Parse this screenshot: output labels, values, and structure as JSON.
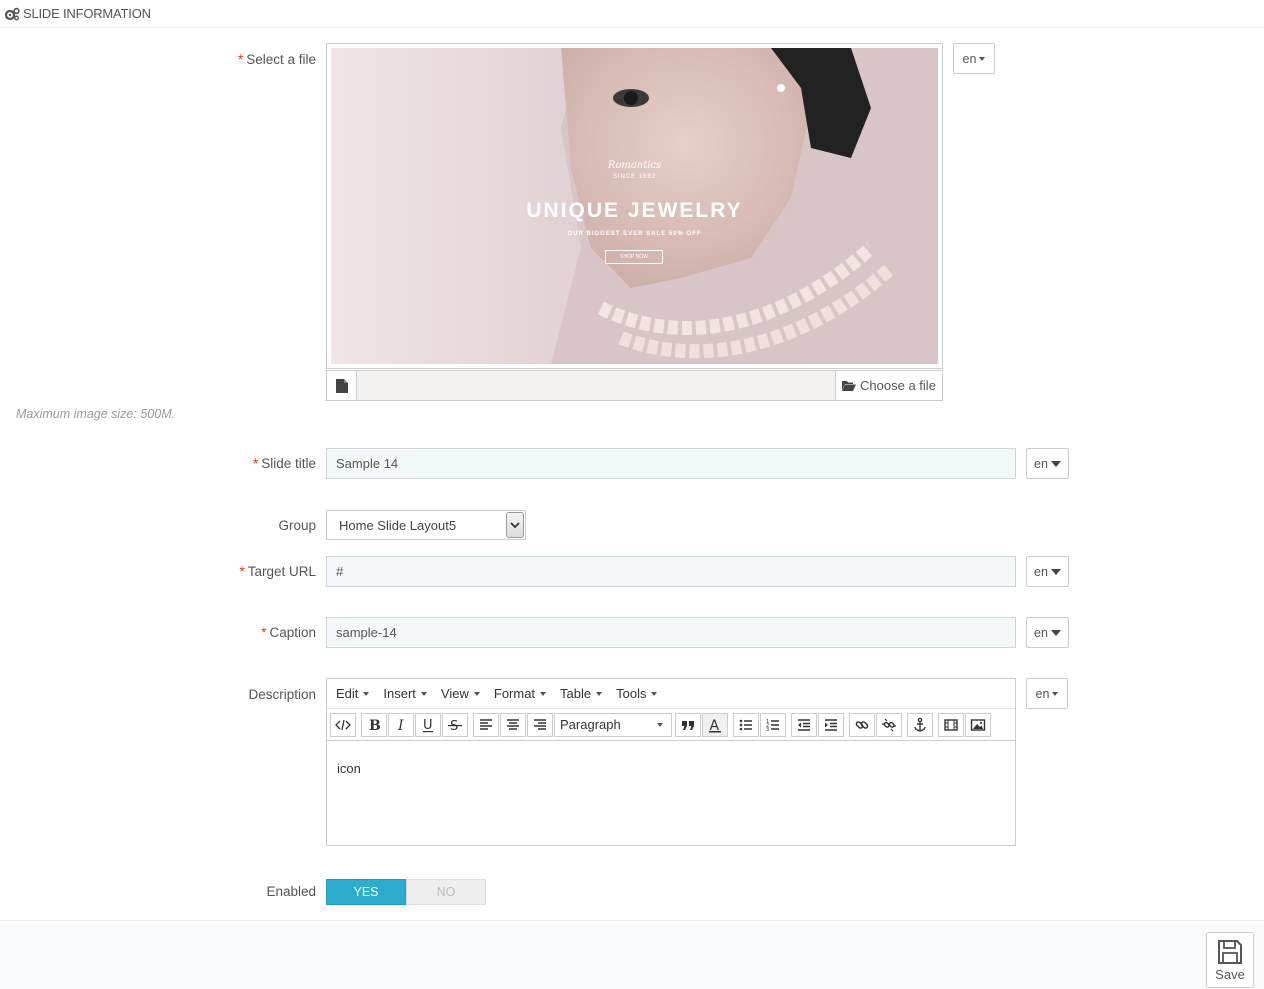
{
  "panel": {
    "title": "SLIDE INFORMATION"
  },
  "fields": {
    "select_file": {
      "label": "Select a file",
      "lang": "en",
      "choose_label": "Choose a file",
      "hint": "Maximum image size: 500M."
    },
    "slide_title": {
      "label": "Slide title",
      "value": "Sample 14",
      "lang": "en"
    },
    "group": {
      "label": "Group",
      "value": "Home Slide Layout5"
    },
    "target_url": {
      "label": "Target URL",
      "value": "#",
      "lang": "en"
    },
    "caption": {
      "label": "Caption",
      "value": "sample-14",
      "lang": "en"
    },
    "description": {
      "label": "Description",
      "lang": "en",
      "content": "icon"
    },
    "enabled": {
      "label": "Enabled",
      "yes": "YES",
      "no": "NO",
      "value": true
    }
  },
  "editor": {
    "menus": [
      "Edit",
      "Insert",
      "View",
      "Format",
      "Table",
      "Tools"
    ],
    "paragraph": "Paragraph"
  },
  "banner": {
    "badge_top": "Romantics",
    "badge_sub": "SINCE 1892",
    "headline": "UNIQUE JEWELRY",
    "subline": "OUR BIGGEST EVER SALE 50% OFF",
    "cta": "SHOP NOW"
  },
  "footer": {
    "save_label": "Save"
  },
  "colors": {
    "accent": "#2eacce",
    "required": "#ee3300"
  }
}
